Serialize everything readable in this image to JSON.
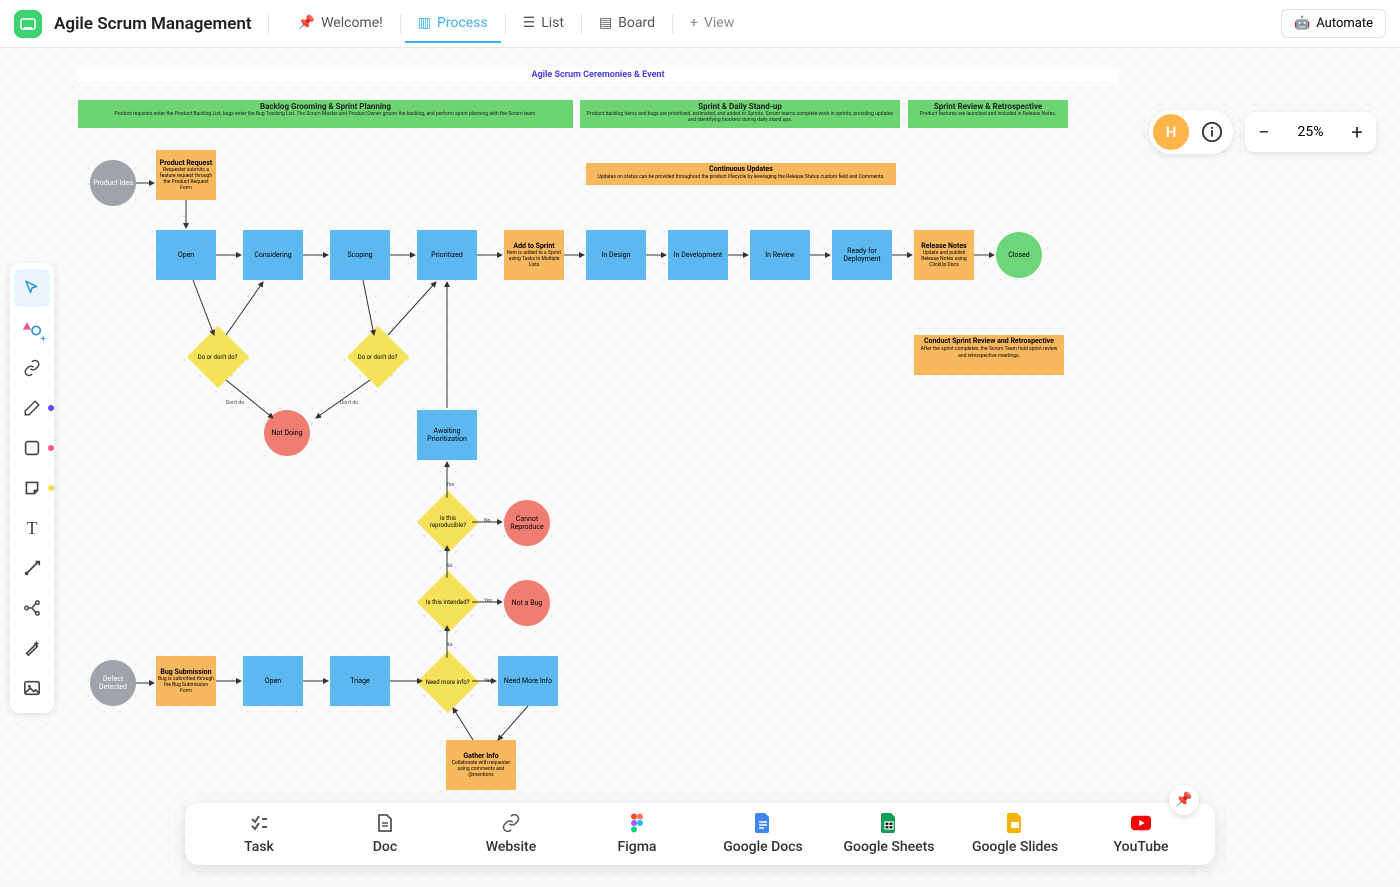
{
  "app": {
    "title": "Agile Scrum Management"
  },
  "tabs": {
    "welcome": "Welcome!",
    "process": "Process",
    "list": "List",
    "board": "Board",
    "add_view": "View"
  },
  "topbar": {
    "automate": "Automate"
  },
  "avatar": {
    "initial": "H"
  },
  "zoom": {
    "value": "25%"
  },
  "tools": {
    "pointer": "pointer",
    "shapes": "shapes",
    "link": "link",
    "pen": "pen",
    "rect": "rectangle",
    "note": "sticky-note",
    "text": "text",
    "connector": "connector",
    "mindmap": "mindmap",
    "ai": "ai-magic",
    "image": "image"
  },
  "bottom": {
    "task": "Task",
    "doc": "Doc",
    "website": "Website",
    "figma": "Figma",
    "gdocs": "Google Docs",
    "gsheets": "Google Sheets",
    "gslides": "Google Slides",
    "youtube": "YouTube"
  },
  "diagram": {
    "title": "Agile Scrum Ceremonies & Event",
    "headers": {
      "h1": {
        "title": "Backlog Grooming & Sprint Planning",
        "desc": "Product requests enter the Product Backlog List, bugs enter the Bug Tracking List. The Scrum Master and Product Owner groom the backlog, and perform sprint planning with the Scrum team."
      },
      "h2": {
        "title": "Sprint & Daily Stand-up",
        "desc": "Product backlog items and bugs are prioritized, estimated, and added to Sprints. Scrum teams complete work in sprints, providing updates and identifying blockers during daily stand ups."
      },
      "h3": {
        "title": "Sprint Review & Retrospective",
        "desc": "Product features are launched and included in Release Notes."
      }
    },
    "continuous": {
      "title": "Continuous Updates",
      "desc": "Updates on status can be provided throughout the product lifecycle by leveraging the Release Status custom field and Comments."
    },
    "retro": {
      "title": "Conduct Sprint Review and Retrospective",
      "desc": "After the sprint completes, the Scrum Team hold sprint review and retrospective meetings."
    },
    "nodes": {
      "product_idea": "Product Idea",
      "product_request": {
        "t": "Product Request",
        "d": "Requester submits a feature request through the Product Request Form"
      },
      "open": "Open",
      "considering": "Considering",
      "scoping": "Scoping",
      "prioritized": "Prioritized",
      "add_to_sprint": {
        "t": "Add to Sprint",
        "d": "Item is added to a Sprint using Tasks in Multiple Lists"
      },
      "in_design": "In Design",
      "in_development": "In Development",
      "in_review": "In Review",
      "ready_deploy": "Ready for Deployment",
      "release_notes": {
        "t": "Release Notes",
        "d": "Update and publish Release Notes using ClickUp Docs"
      },
      "closed": "Closed",
      "do_dont1": "Do or don't do?",
      "do_dont2": "Do or don't do?",
      "not_doing": "Not Doing",
      "awaiting": "Awaiting Prioritization",
      "reproducible": "Is this reproducible?",
      "cannot_repro": "Cannot Reproduce",
      "intended": "Is this intended?",
      "not_bug": "Not a Bug",
      "defect": "Defect Detected",
      "bug_sub": {
        "t": "Bug Submission",
        "d": "Bug is submitted through the Bug Submission Form"
      },
      "bug_open": "Open",
      "triage": "Triage",
      "more_info": "Need more info?",
      "need_more": "Need More Info",
      "gather": {
        "t": "Gather Info",
        "d": "Collaborate with requester using comments and @mentions"
      }
    },
    "labels": {
      "dont_do_1": "Don't do",
      "dont_do_2": "Don't do",
      "yes": "Yes",
      "no": "No"
    }
  }
}
